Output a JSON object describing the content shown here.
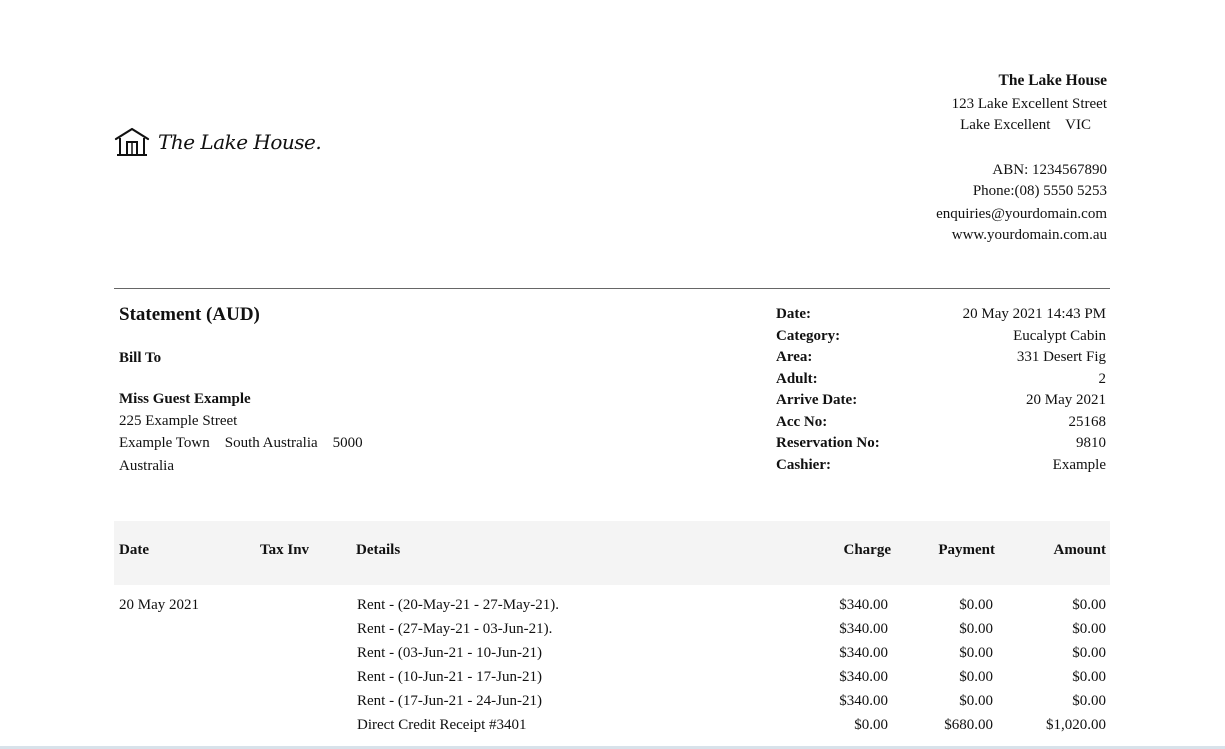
{
  "logo": {
    "icon": "house-icon",
    "text": "The Lake House."
  },
  "company": {
    "name": "The Lake House",
    "street": "123 Lake Excellent Street",
    "locality": "Lake Excellent    VIC",
    "abn": "ABN: 1234567890",
    "phone": "Phone:(08) 5550 5253",
    "email": "enquiries@yourdomain.com",
    "website": "www.yourdomain.com.au"
  },
  "statement": {
    "title": "Statement (AUD)",
    "bill_to_label": "Bill To"
  },
  "bill_to": {
    "name": "Miss Guest Example",
    "street": "225 Example Street",
    "locality": "Example Town    South Australia    5000",
    "country": "Australia"
  },
  "meta": [
    {
      "label": "Date:",
      "value": "20 May 2021 14:43 PM"
    },
    {
      "label": "Category:",
      "value": "Eucalypt Cabin"
    },
    {
      "label": "Area:",
      "value": "331 Desert Fig"
    },
    {
      "label": "Adult:",
      "value": "2"
    },
    {
      "label": "Arrive Date:",
      "value": "20 May 2021"
    },
    {
      "label": "Acc No:",
      "value": "25168"
    },
    {
      "label": "Reservation No:",
      "value": "9810"
    },
    {
      "label": "Cashier:",
      "value": "Example"
    }
  ],
  "table": {
    "headers": {
      "date": "Date",
      "tax_inv": "Tax Inv",
      "details": "Details",
      "charge": "Charge",
      "payment": "Payment",
      "amount": "Amount"
    },
    "rows": [
      {
        "date": "20 May 2021",
        "tax_inv": "",
        "details": "Rent - (20-May-21 - 27-May-21).",
        "charge": "$340.00",
        "payment": "$0.00",
        "amount": "$0.00"
      },
      {
        "date": "",
        "tax_inv": "",
        "details": "Rent - (27-May-21 - 03-Jun-21).",
        "charge": "$340.00",
        "payment": "$0.00",
        "amount": "$0.00"
      },
      {
        "date": "",
        "tax_inv": "",
        "details": "Rent - (03-Jun-21 - 10-Jun-21)",
        "charge": "$340.00",
        "payment": "$0.00",
        "amount": "$0.00"
      },
      {
        "date": "",
        "tax_inv": "",
        "details": "Rent - (10-Jun-21 - 17-Jun-21)",
        "charge": "$340.00",
        "payment": "$0.00",
        "amount": "$0.00"
      },
      {
        "date": "",
        "tax_inv": "",
        "details": "Rent - (17-Jun-21 - 24-Jun-21)",
        "charge": "$340.00",
        "payment": "$0.00",
        "amount": "$0.00"
      },
      {
        "date": "",
        "tax_inv": "",
        "details": "Direct Credit Receipt #3401",
        "charge": "$0.00",
        "payment": "$680.00",
        "amount": "$1,020.00"
      }
    ]
  }
}
